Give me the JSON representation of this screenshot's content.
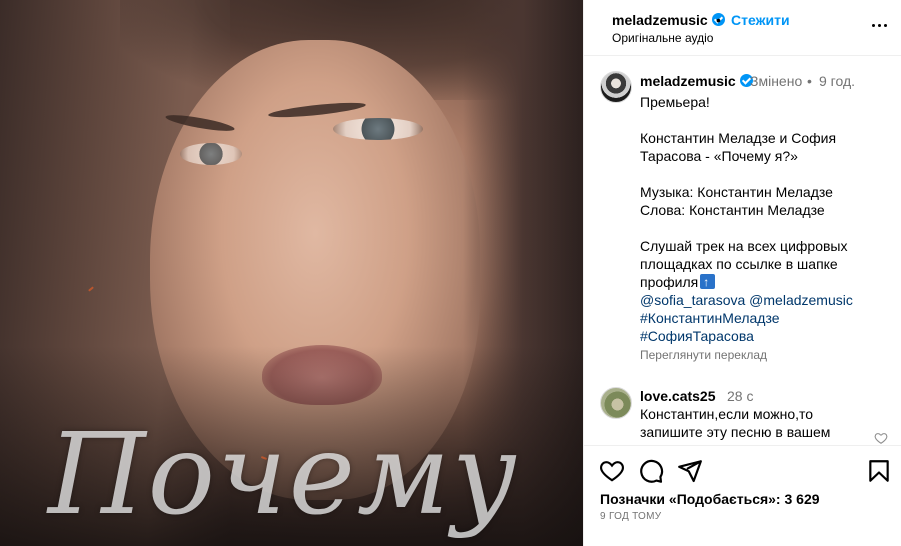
{
  "media": {
    "overlay_title": "Почему"
  },
  "header": {
    "username": "meladzemusic",
    "separator": "•",
    "follow_label": "Стежити",
    "audio_label": "Оригінальне аудіо"
  },
  "post": {
    "username": "meladzemusic",
    "edited_label": "Змінено",
    "separator": "•",
    "time": "9 год.",
    "caption": {
      "line1": "Премьера!",
      "line2": "Константин Меладзе и София Тарасова - «Почему я?»",
      "line3": "Музыка: Константин Меладзе",
      "line4": "Слова: Константин Меладзе",
      "line5": "Слушай трек на всех цифровых площадках по ссылке в шапке профиля",
      "mention1": "@sofia_tarasova",
      "mention2": "@meladzemusic",
      "hashtag1": "#КонстантинМеладзе",
      "hashtag2": "#СофияТарасова"
    },
    "translate_label": "Переглянути переклад"
  },
  "comment": {
    "username": "love.cats25",
    "time": "28 с",
    "text": "Константин,если можно,то запишите эту песню в вашем"
  },
  "footer": {
    "likes_prefix": "Позначки «Подобається»:",
    "likes_count": "3 629",
    "timestamp": "9 ГОД ТОМУ"
  },
  "colors": {
    "accent": "#0095f6",
    "link": "#00376b",
    "muted": "#737373"
  },
  "icons": {
    "heart": "heart-icon",
    "comment": "comment-icon",
    "share": "paper-plane-icon",
    "save": "bookmark-icon",
    "more": "more-horizontal-icon",
    "verified": "verified-badge-icon"
  }
}
